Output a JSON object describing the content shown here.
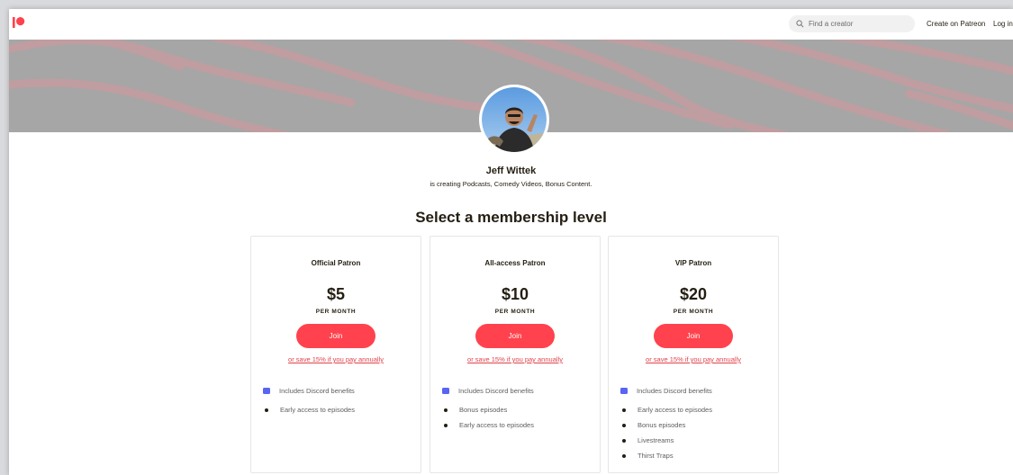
{
  "topbar": {
    "search_placeholder": "Find a creator",
    "create_link": "Create on Patreon",
    "login_link": "Log in"
  },
  "colors": {
    "brand": "#ff424d",
    "banner_bg": "#a6a6a6",
    "banner_stripe": "#c29da0",
    "discord": "#5865f2"
  },
  "creator": {
    "name": "Jeff Wittek",
    "description": "is creating Podcasts, Comedy Videos, Bonus Content."
  },
  "section_title": "Select a membership level",
  "tiers": [
    {
      "name": "Official Patron",
      "price": "$5",
      "period": "PER MONTH",
      "join_label": "Join",
      "annual_label": "or save 15% if you pay annually",
      "discord_label": "Includes Discord benefits",
      "benefits": [
        "Early access to episodes"
      ]
    },
    {
      "name": "All-access Patron",
      "price": "$10",
      "period": "PER MONTH",
      "join_label": "Join",
      "annual_label": "or save 15% if you pay annually",
      "discord_label": "Includes Discord benefits",
      "benefits": [
        "Bonus episodes",
        "Early access to episodes"
      ]
    },
    {
      "name": "VIP Patron",
      "price": "$20",
      "period": "PER MONTH",
      "join_label": "Join",
      "annual_label": "or save 15% if you pay annually",
      "discord_label": "Includes Discord benefits",
      "benefits": [
        "Early access to episodes",
        "Bonus episodes",
        "Livestreams",
        "Thirst Traps"
      ]
    }
  ]
}
